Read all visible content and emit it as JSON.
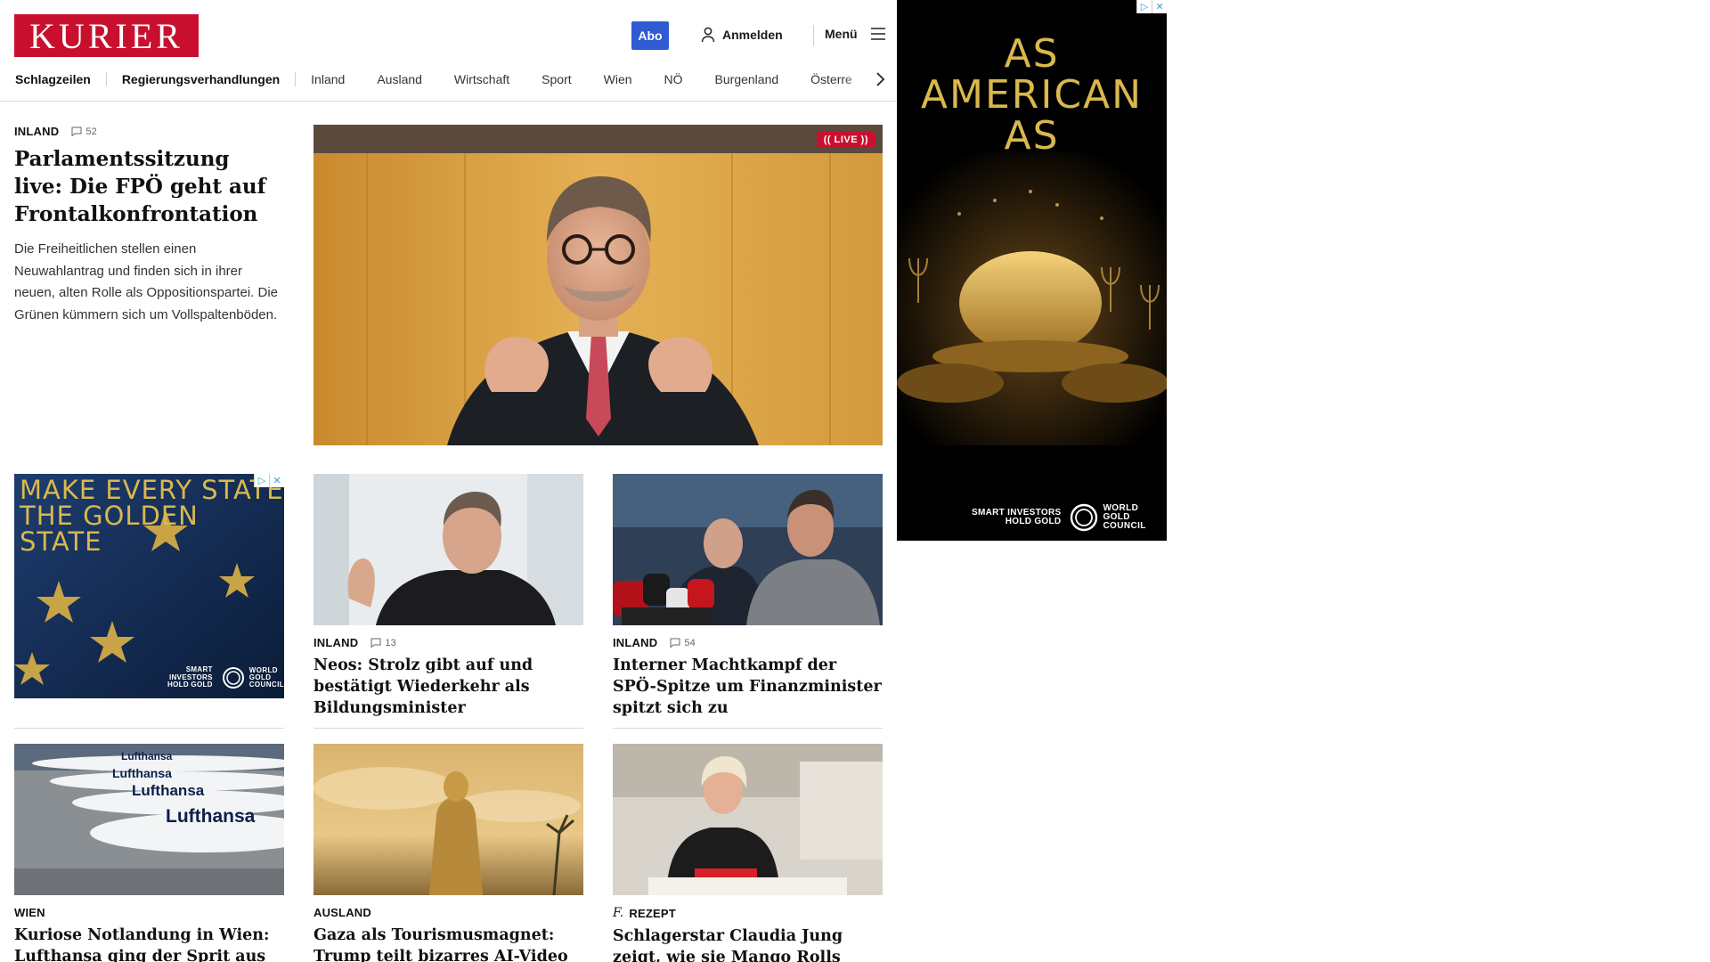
{
  "header": {
    "logo_text": "KURIER",
    "abo_label": "Abo",
    "login_label": "Anmelden",
    "menu_label": "Menü",
    "brand_color": "#c8102e",
    "abo_color": "#2f5bd3"
  },
  "nav": {
    "items": [
      "Schlagzeilen",
      "Regierungsverhandlungen",
      "Inland",
      "Ausland",
      "Wirtschaft",
      "Sport",
      "Wien",
      "NÖ",
      "Burgenland",
      "Österre"
    ]
  },
  "lead": {
    "category": "INLAND",
    "comments": "52",
    "title": "Parlamentssitzung live: Die FPÖ geht auf Frontalkonfrontation",
    "teaser": "Die Freiheitlichen stellen einen Neuwahlantrag und finden sich in ihrer neuen, alten Rolle als Oppositionspartei. Die Grünen kümmern sich um Vollspaltenböden.",
    "badge": "LIVE"
  },
  "cards": [
    {
      "category": "INLAND",
      "comments": "13",
      "title": "Neos: Strolz gibt auf und bestätigt Wiederkehr als Bildungsminister"
    },
    {
      "category": "INLAND",
      "comments": "54",
      "title": "Interner Machtkampf der SPÖ-Spitze um Finanzminister spitzt sich zu"
    },
    {
      "category": "WIEN",
      "title": "Kuriose Notlandung in Wien: Lufthansa ging der Sprit aus"
    },
    {
      "category": "AUSLAND",
      "title": "Gaza als Tourismusmagnet: Trump teilt bizarres AI-Video"
    },
    {
      "category": "REZEPT",
      "title": "Schlagerstar Claudia Jung zeigt, wie sie Mango Rolls macht"
    }
  ],
  "ads": {
    "small": {
      "headline": [
        "MAKE EVERY STATE",
        "THE GOLDEN",
        "STATE"
      ],
      "tagline": [
        "SMART INVESTORS",
        "HOLD GOLD"
      ],
      "brand": [
        "WORLD",
        "GOLD",
        "COUNCIL"
      ]
    },
    "right": {
      "headline": [
        "AS",
        "AMERICAN",
        "AS"
      ],
      "tagline": [
        "SMART INVESTORS",
        "HOLD GOLD"
      ],
      "brand": [
        "WORLD",
        "GOLD",
        "COUNCIL"
      ]
    }
  },
  "icons": {
    "login": "user-icon",
    "menu": "hamburger-icon",
    "nav_next": "chevron-right-icon",
    "comments": "comment-bubble-icon",
    "rezept": "recipe-f-icon"
  }
}
